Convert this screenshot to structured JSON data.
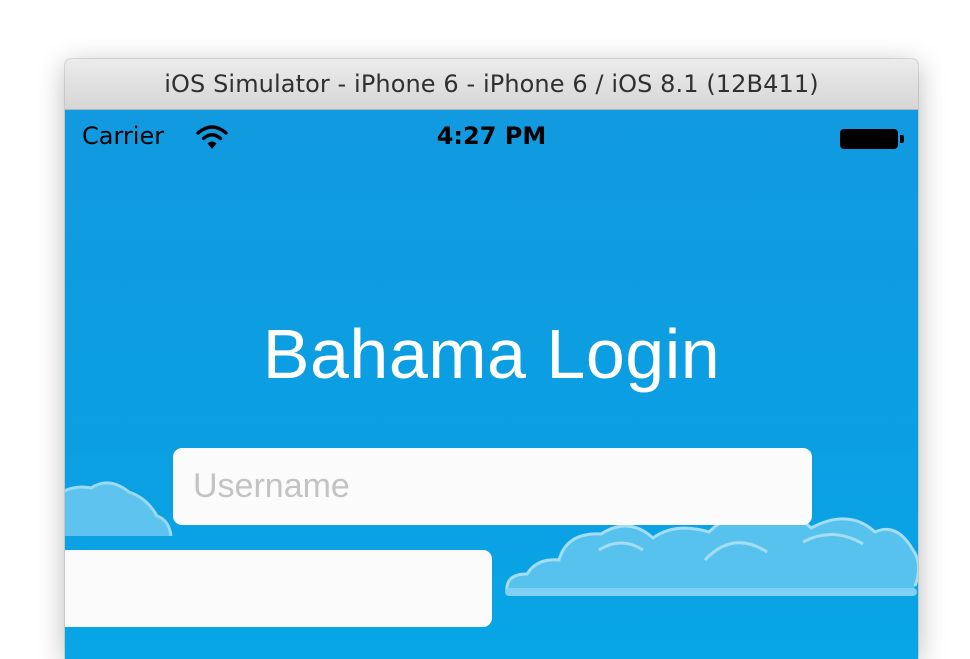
{
  "window": {
    "title": "iOS Simulator - iPhone 6 - iPhone 6 / iOS 8.1 (12B411)"
  },
  "status_bar": {
    "carrier": "Carrier",
    "time": "4:27 PM",
    "wifi_icon": "wifi-icon",
    "battery_icon": "battery-icon"
  },
  "app": {
    "title": "Bahama Login",
    "username": {
      "value": "",
      "placeholder": "Username"
    },
    "password": {
      "value": "",
      "placeholder": ""
    }
  },
  "colors": {
    "sky": "#0e9ee0",
    "cloud": "#5dc4ee",
    "field_bg": "#fbfbfb",
    "placeholder": "#c3c3c3"
  }
}
